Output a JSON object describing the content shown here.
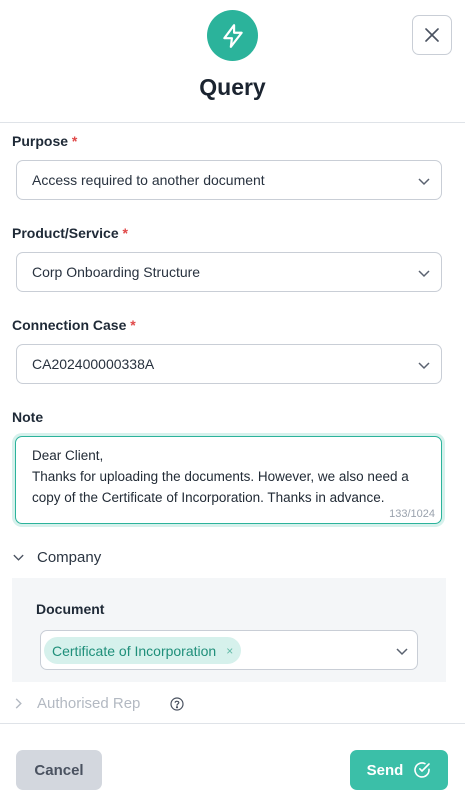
{
  "dialog": {
    "title": "Query",
    "icon": "lightning-bolt-icon",
    "accent_color": "#2bb39b"
  },
  "form": {
    "purpose": {
      "label": "Purpose",
      "required_mark": "*",
      "value": "Access required to another document"
    },
    "product_service": {
      "label": "Product/Service",
      "required_mark": "*",
      "value": "Corp Onboarding Structure"
    },
    "connection_case": {
      "label": "Connection Case",
      "required_mark": "*",
      "value": "CA202400000338A"
    },
    "note": {
      "label": "Note",
      "value": "Dear Client,\nThanks for uploading the documents. However, we also need a copy of the Certificate of Incorporation. Thanks in advance.",
      "counter": "133/1024"
    }
  },
  "sections": {
    "company": {
      "label": "Company",
      "expanded": true,
      "document_label": "Document",
      "document_tags": [
        "Certificate of Incorporation"
      ],
      "tag_remove": "×"
    },
    "authorised_rep": {
      "label": "Authorised Rep",
      "expanded": false
    }
  },
  "footer": {
    "cancel_label": "Cancel",
    "send_label": "Send"
  }
}
